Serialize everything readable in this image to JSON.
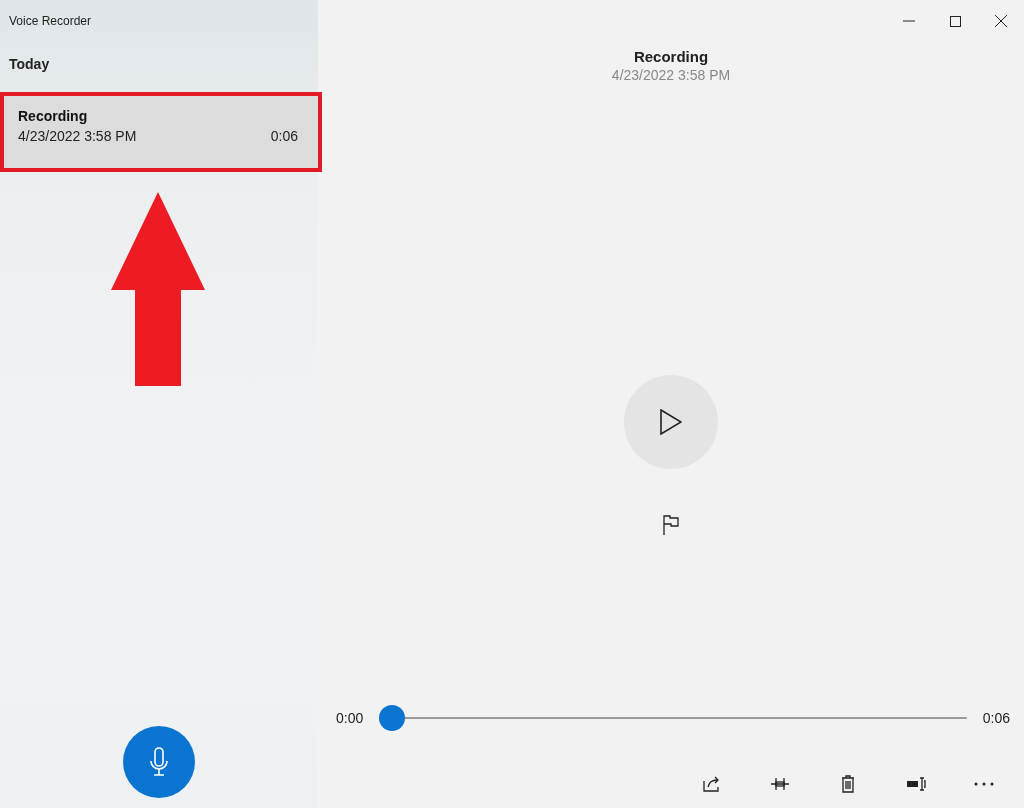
{
  "window": {
    "title": "Voice Recorder"
  },
  "list": {
    "section": "Today",
    "items": [
      {
        "title": "Recording",
        "date": "4/23/2022 3:58 PM",
        "duration": "0:06",
        "selected": true,
        "annotated": true
      }
    ]
  },
  "player": {
    "title": "Recording",
    "date": "4/23/2022 3:58 PM",
    "elapsed": "0:00",
    "total": "0:06",
    "level": 0
  },
  "toolbar": [
    {
      "kind": "share"
    },
    {
      "kind": "trim"
    },
    {
      "kind": "delete"
    },
    {
      "kind": "rename"
    },
    {
      "kind": "more"
    }
  ]
}
